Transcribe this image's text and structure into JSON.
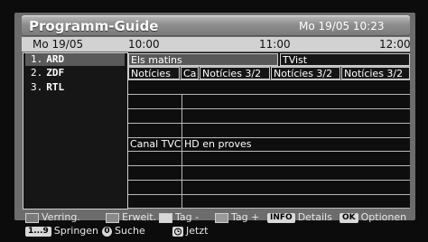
{
  "title": "Programm-Guide",
  "current_datetime": "Mo 19/05 10:23",
  "header": {
    "date": "Mo 19/05",
    "times": [
      "10:00",
      "11:00",
      "12:00"
    ]
  },
  "channels": [
    {
      "number": "1.",
      "name": "ARD"
    },
    {
      "number": "2.",
      "name": "ZDF"
    },
    {
      "number": "3.",
      "name": "RTL"
    }
  ],
  "programmes": {
    "row1": [
      "Els matins",
      "TVist"
    ],
    "row2": [
      "Notícies",
      "Ca",
      "Notícies 3/2",
      "Notícies 3/2",
      "Notícies 3/2"
    ],
    "row8": [
      "Canal TVC",
      "HD en proves"
    ]
  },
  "footer": {
    "red_label": "Verring.",
    "green_label": "Erweit.",
    "yellow_label": "Tag -",
    "blue_label": "Tag +",
    "info_key": "INFO",
    "info_label": "Details",
    "ok_key": "OK",
    "ok_label": "Optionen",
    "digits_key": "1...9",
    "digits_label": "Springen",
    "search_key": "0",
    "search_label": "Suche",
    "now_label": "Jetzt"
  },
  "colors": {
    "panel": "#6c6c6c",
    "header_row": "#d2d2d2",
    "selection": "#585858"
  }
}
